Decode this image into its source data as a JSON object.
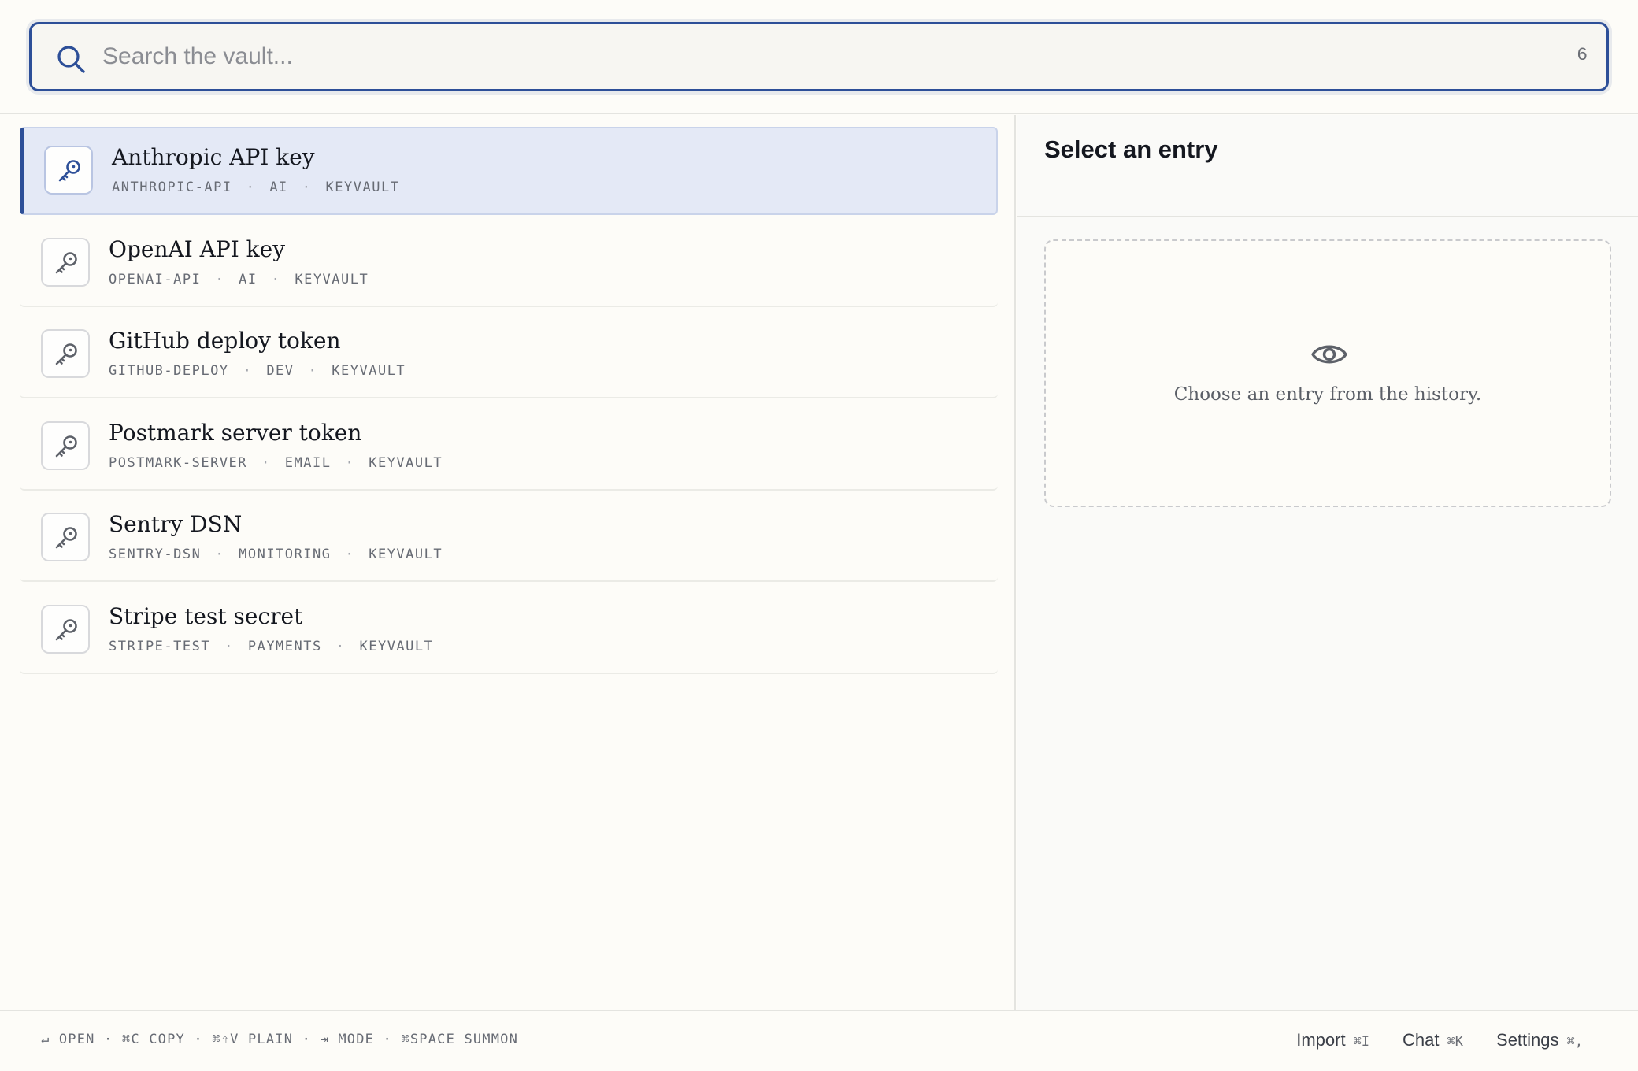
{
  "search": {
    "placeholder": "Search the vault...",
    "value": "",
    "count": "6"
  },
  "entries": [
    {
      "title": "Anthropic API key",
      "id": "ANTHROPIC-API",
      "category": "AI",
      "source": "KEYVAULT",
      "selected": true
    },
    {
      "title": "OpenAI API key",
      "id": "OPENAI-API",
      "category": "AI",
      "source": "KEYVAULT",
      "selected": false
    },
    {
      "title": "GitHub deploy token",
      "id": "GITHUB-DEPLOY",
      "category": "DEV",
      "source": "KEYVAULT",
      "selected": false
    },
    {
      "title": "Postmark server token",
      "id": "POSTMARK-SERVER",
      "category": "EMAIL",
      "source": "KEYVAULT",
      "selected": false
    },
    {
      "title": "Sentry DSN",
      "id": "SENTRY-DSN",
      "category": "MONITORING",
      "source": "KEYVAULT",
      "selected": false
    },
    {
      "title": "Stripe test secret",
      "id": "STRIPE-TEST",
      "category": "PAYMENTS",
      "source": "KEYVAULT",
      "selected": false
    }
  ],
  "detail": {
    "title": "Select an entry",
    "empty_text": "Choose an entry from the history."
  },
  "footer": {
    "shortcuts": "↵ OPEN · ⌘C COPY · ⌘⇧V PLAIN · ⇥ MODE · ⌘SPACE SUMMON",
    "import_label": "Import",
    "import_kbd": "⌘I",
    "chat_label": "Chat",
    "chat_kbd": "⌘K",
    "settings_label": "Settings",
    "settings_kbd": "⌘,"
  },
  "icons": {
    "search": "search-icon",
    "entry": "key-icon",
    "empty": "eye-icon"
  },
  "colors": {
    "accent": "#2d4f98",
    "selected_bg": "#e4e9f6",
    "background": "#fdfcf8"
  }
}
